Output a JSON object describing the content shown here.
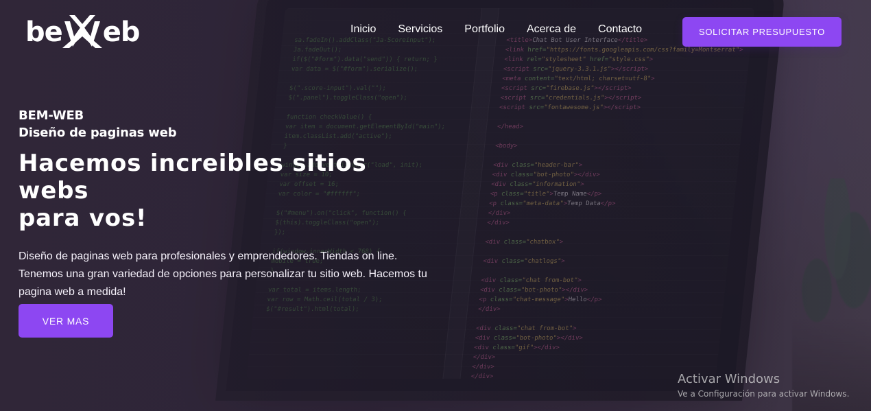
{
  "brand": {
    "logo_left": "be",
    "logo_right": "eb"
  },
  "nav": {
    "items": [
      {
        "label": "Inicio"
      },
      {
        "label": "Servicios"
      },
      {
        "label": "Portfolio"
      },
      {
        "label": "Acerca de"
      },
      {
        "label": "Contacto"
      }
    ],
    "cta_label": "SOLICITAR PRESUPUESTO"
  },
  "hero": {
    "eyebrow_1": "BEM-WEB",
    "eyebrow_2": "Diseño de paginas web",
    "title_line_1": "Hacemos increibles sitios webs",
    "title_line_2": "para vos!",
    "description": "Diseño de paginas web para profesionales y emprendedores. Tiendas on line. Tenemos una gran variedad de opciones para personalizar tu sitio web. Hacemos tu pagina web a medida!",
    "button_label": "VER MAS"
  },
  "windows_notice": {
    "title": "Activar Windows",
    "subtitle": "Ve a Configuración para activar Windows."
  },
  "icons": {
    "logo_mark": "stylized-w-logo-icon"
  },
  "colors": {
    "accent": "#8D47F2",
    "text": "#FFFFFF"
  }
}
